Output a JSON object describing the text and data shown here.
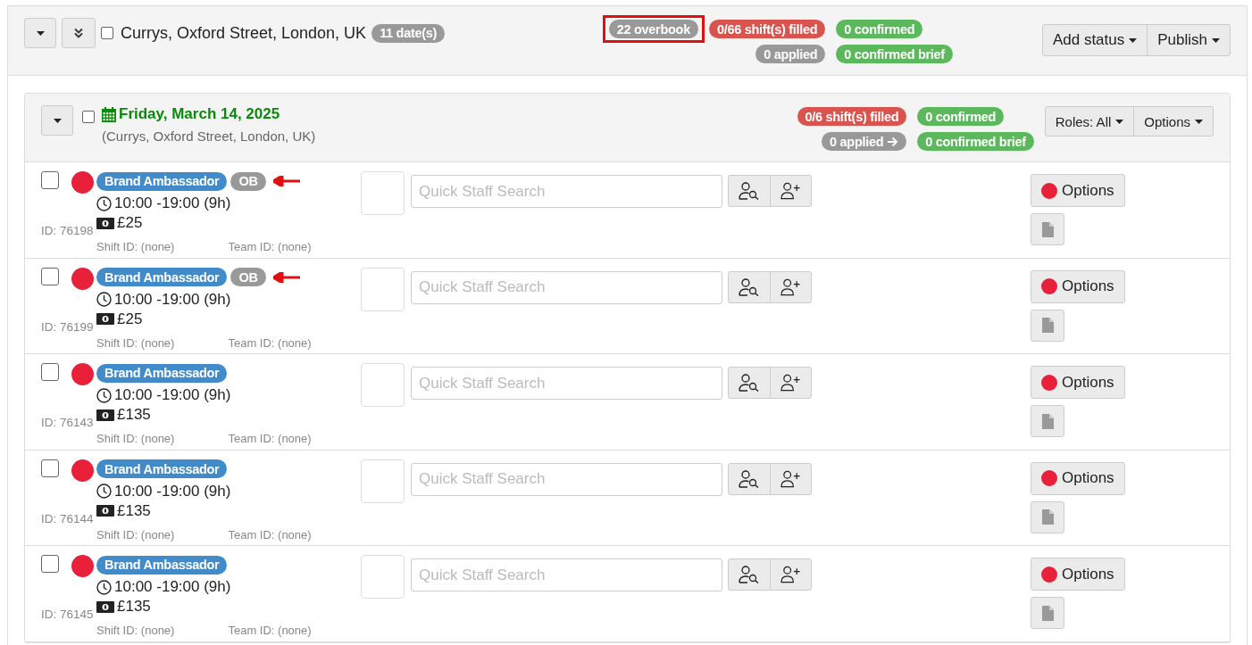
{
  "location": {
    "title": "Currys, Oxford Street, London, UK",
    "checked": false,
    "dates_badge": "11 date(s)",
    "badge_rows": [
      {
        "left": [
          {
            "text": "22 overbook",
            "kind": "neutral",
            "highlighted": true
          },
          {
            "text": "0/66 shift(s) filled",
            "kind": "danger",
            "highlighted": false
          }
        ],
        "right": {
          "text": "0 confirmed",
          "kind": "success",
          "highlighted": false
        }
      },
      {
        "left": [
          {
            "text": "0 applied",
            "kind": "neutral",
            "highlighted": false
          }
        ],
        "right": {
          "text": "0 confirmed brief",
          "kind": "success",
          "highlighted": false
        }
      }
    ],
    "buttons": [
      "Add status",
      "Publish"
    ]
  },
  "date": {
    "title": "Friday, March 14, 2025",
    "subtitle": "(Currys, Oxford Street, London, UK)",
    "checked": false,
    "badge_rows": [
      {
        "left": [
          {
            "text": "0/6 shift(s) filled",
            "kind": "danger"
          }
        ],
        "right": {
          "text": "0 confirmed",
          "kind": "success"
        }
      },
      {
        "left": [
          {
            "text": "0 applied",
            "kind": "neutral",
            "arrow": true
          }
        ],
        "right": {
          "text": "0 confirmed brief",
          "kind": "success"
        }
      }
    ],
    "buttons": [
      "Roles: All",
      "Options"
    ]
  },
  "shifts": [
    {
      "checked": false,
      "color": "#e8203a",
      "role": "Brand Ambassador",
      "ob": "OB",
      "flagged": true,
      "time": "10:00 -19:00 (9h)",
      "pay": "£25",
      "id": "ID: 76198",
      "shift_id": "Shift ID: (none)",
      "team_id": "Team ID: (none)",
      "search_placeholder": "Quick Staff Search",
      "options": "Options"
    },
    {
      "checked": false,
      "color": "#e8203a",
      "role": "Brand Ambassador",
      "ob": "OB",
      "flagged": true,
      "time": "10:00 -19:00 (9h)",
      "pay": "£25",
      "id": "ID: 76199",
      "shift_id": "Shift ID: (none)",
      "team_id": "Team ID: (none)",
      "search_placeholder": "Quick Staff Search",
      "options": "Options"
    },
    {
      "checked": false,
      "color": "#e8203a",
      "role": "Brand Ambassador",
      "flagged": false,
      "time": "10:00 -19:00 (9h)",
      "pay": "£135",
      "id": "ID: 76143",
      "shift_id": "Shift ID: (none)",
      "team_id": "Team ID: (none)",
      "search_placeholder": "Quick Staff Search",
      "options": "Options"
    },
    {
      "checked": false,
      "color": "#e8203a",
      "role": "Brand Ambassador",
      "flagged": false,
      "time": "10:00 -19:00 (9h)",
      "pay": "£135",
      "id": "ID: 76144",
      "shift_id": "Shift ID: (none)",
      "team_id": "Team ID: (none)",
      "search_placeholder": "Quick Staff Search",
      "options": "Options"
    },
    {
      "checked": false,
      "color": "#e8203a",
      "role": "Brand Ambassador",
      "flagged": false,
      "time": "10:00 -19:00 (9h)",
      "pay": "£135",
      "id": "ID: 76145",
      "shift_id": "Shift ID: (none)",
      "team_id": "Team ID: (none)",
      "search_placeholder": "Quick Staff Search",
      "options": "Options"
    }
  ]
}
